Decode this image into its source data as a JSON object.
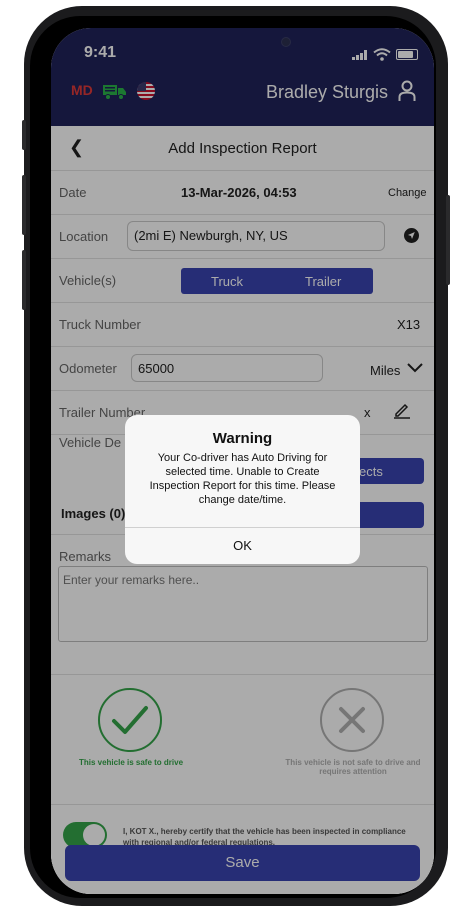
{
  "status_bar": {
    "time": "9:41"
  },
  "header": {
    "md_badge": "MD",
    "user_name": "Bradley Sturgis",
    "colors": {
      "bar": "#20235a",
      "md": "#e03a3a",
      "truck": "#2bb34a"
    }
  },
  "nav": {
    "back_icon": "chevron-left-icon",
    "title": "Add Inspection Report"
  },
  "form": {
    "date": {
      "label": "Date",
      "value": "13-Mar-2026, 04:53",
      "action": "Change"
    },
    "location": {
      "label": "Location",
      "value": "(2mi E) Newburgh, NY, US"
    },
    "vehicles": {
      "label": "Vehicle(s)",
      "options": [
        "Truck",
        "Trailer"
      ]
    },
    "truck_number": {
      "label": "Truck Number",
      "value": "X13"
    },
    "odometer": {
      "label": "Odometer",
      "value": "65000",
      "unit": "Miles"
    },
    "trailer_number": {
      "label": "Trailer Number",
      "clear": "x"
    },
    "vehicle_defects": {
      "label": "Vehicle De",
      "button": "ects"
    },
    "images": {
      "label": "Images (0)"
    },
    "remarks": {
      "label": "Remarks",
      "placeholder": "Enter your remarks here.."
    }
  },
  "safety": {
    "safe_caption": "This vehicle is safe to drive",
    "unsafe_caption": "This vehicle is not safe to drive and requires attention",
    "colors": {
      "safe": "#35a54a",
      "unsafe": "#b0b0b0"
    }
  },
  "certify": {
    "text": "I, KOT X., hereby certify that the vehicle has been inspected in compliance with regional and/or federal regulations.",
    "toggle_on": true
  },
  "save_label": "Save",
  "dialog": {
    "title": "Warning",
    "message": "Your Co-driver has Auto Driving for selected time. Unable to Create Inspection Report for this time. Please change date/time.",
    "ok_label": "OK"
  }
}
